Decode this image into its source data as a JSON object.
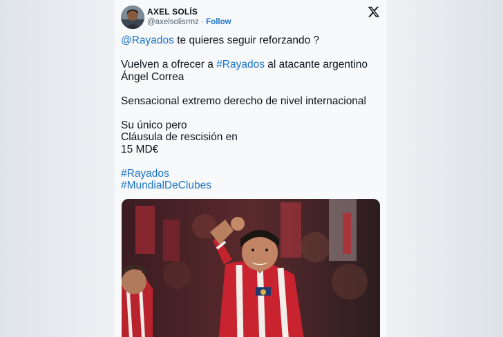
{
  "author": {
    "display_name": "AXEL SOLÍS",
    "handle": "@axelsolisrmz",
    "separator": " · ",
    "follow_label": "Follow"
  },
  "platform_icon": "x-logo-icon",
  "tweet": {
    "line1": {
      "mention": "@Rayados",
      "rest": " te quieres seguir reforzando ?"
    },
    "line2": {
      "pre": "Vuelven a ofrecer a ",
      "hashtag": "#Rayados",
      "post": " al atacante argentino Ángel Correa"
    },
    "line3": "Sensacional extremo derecho de nivel internacional",
    "line4": "Su único pero\nCláusula de rescisión en\n15 MD€",
    "hashtag1": "#Rayados",
    "hashtag2": "#MundialDeClubes"
  },
  "colors": {
    "link": "#1d74c9",
    "text": "#0f1419",
    "muted": "#536471",
    "jersey_red": "#d6202b"
  }
}
